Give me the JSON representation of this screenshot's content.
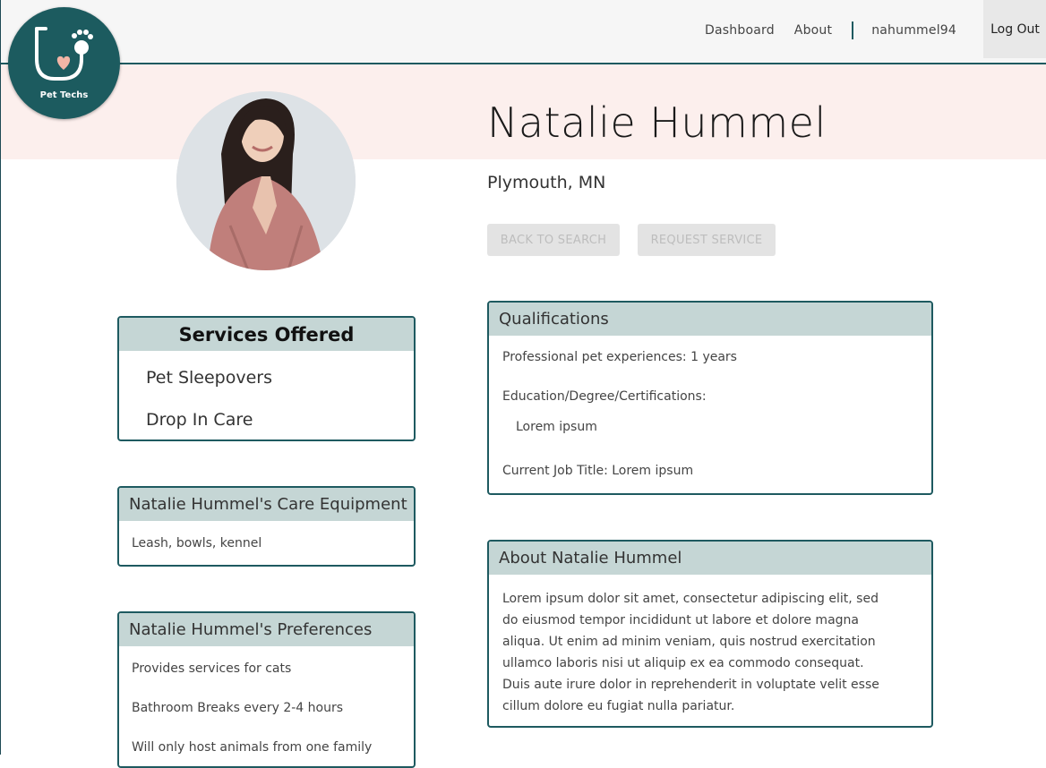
{
  "nav": {
    "brand": "Pet Techs",
    "links": [
      "Dashboard",
      "About"
    ],
    "username": "nahummel94",
    "logout": "Log Out"
  },
  "profile": {
    "name": "Natalie Hummel",
    "location": "Plymouth, MN",
    "buttons": {
      "back": "BACK TO SEARCH",
      "request": "REQUEST SERVICE"
    }
  },
  "services": {
    "title": "Services Offered",
    "items": [
      "Pet Sleepovers",
      "Drop In Care"
    ]
  },
  "equipment": {
    "title": "Natalie Hummel's Care Equipment",
    "text": "Leash, bowls, kennel"
  },
  "preferences": {
    "title": "Natalie Hummel's Preferences",
    "items": [
      "Provides services for cats",
      "Bathroom Breaks every 2-4 hours",
      "Will only host animals from one family"
    ]
  },
  "qualifications": {
    "title": "Qualifications",
    "experience": "Professional pet experiences: 1 years",
    "education_label": "Education/Degree/Certifications:",
    "education_value": "Lorem ipsum",
    "job_title": "Current Job Title: Lorem ipsum"
  },
  "about": {
    "title": "About Natalie Hummel",
    "lines": [
      "Lorem ipsum dolor sit amet, consectetur adipiscing elit, sed",
      "do eiusmod tempor incididunt ut labore et dolore magna",
      "aliqua. Ut enim ad minim veniam, quis nostrud exercitation",
      "ullamco laboris nisi ut aliquip ex ea commodo consequat.",
      "Duis aute irure dolor in reprehenderit in voluptate velit esse",
      "cillum dolore eu fugiat nulla pariatur."
    ]
  }
}
